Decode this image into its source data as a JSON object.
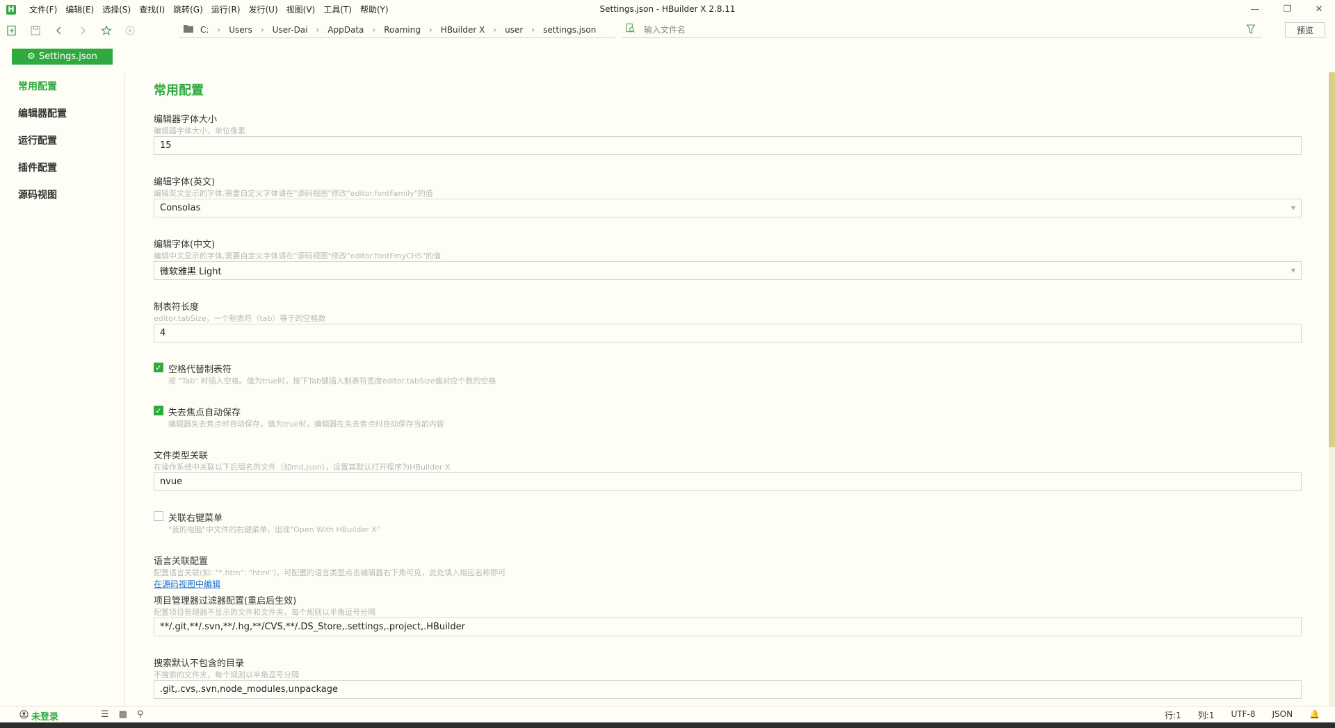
{
  "window": {
    "title": "Settings.json - HBuilder X 2.8.11",
    "logo": "H"
  },
  "menu": [
    "文件(F)",
    "编辑(E)",
    "选择(S)",
    "查找(I)",
    "跳转(G)",
    "运行(R)",
    "发行(U)",
    "视图(V)",
    "工具(T)",
    "帮助(Y)"
  ],
  "breadcrumb": [
    "C:",
    "Users",
    "User-Dai",
    "AppData",
    "Roaming",
    "HBuilder X",
    "user",
    "settings.json"
  ],
  "search": {
    "placeholder": "输入文件名"
  },
  "toolbar": {
    "preview_label": "预览"
  },
  "tab": {
    "label": "Settings.json"
  },
  "sidenav": {
    "items": [
      "常用配置",
      "编辑器配置",
      "运行配置",
      "插件配置",
      "源码视图"
    ]
  },
  "section": {
    "title": "常用配置"
  },
  "fields": {
    "font_size": {
      "label": "编辑器字体大小",
      "desc": "编辑器字体大小，单位像素",
      "value": "15"
    },
    "font_en": {
      "label": "编辑字体(英文)",
      "desc": "编辑英文显示的字体,需要自定义字体请在\"源码视图\"修改\"editor.fontFamily\"的值",
      "value": "Consolas"
    },
    "font_cn": {
      "label": "编辑字体(中文)",
      "desc": "编辑中文显示的字体,需要自定义字体请在\"源码视图\"修改\"editor.fontFmyCHS\"的值",
      "value": "微软雅黑 Light"
    },
    "tab_size": {
      "label": "制表符长度",
      "desc": "editor.tabSize，一个制表符（tab）等于的空格数",
      "value": "4"
    },
    "insert_spaces": {
      "label": "空格代替制表符",
      "desc": "按 \"Tab\" 时插入空格。值为true时，按下Tab键插入制表符宽度editor.tabSize值对应个数的空格",
      "checked": true
    },
    "auto_save": {
      "label": "失去焦点自动保存",
      "desc": "编辑器失去焦点时自动保存。值为true时，编辑器在失去焦点时自动保存当前内容",
      "checked": true
    },
    "file_assoc": {
      "label": "文件类型关联",
      "desc": "在操作系统中关联以下后缀名的文件（如md,json），设置其默认打开程序为HBuilder X",
      "value": "nvue"
    },
    "context_menu": {
      "label": "关联右键菜单",
      "desc": "\"我的电脑\"中文件的右键菜单，出现\"Open With HBuilder X\"",
      "checked": false
    },
    "lang_assoc": {
      "label": "语言关联配置",
      "desc": "配置语言关联(如: \"*.htm\": \"html\")，可配置的语言类型点击编辑器右下角可见，此处填入相应名称即可",
      "link": "在源码视图中编辑"
    },
    "project_filter": {
      "label": "项目管理器过滤器配置(重启后生效)",
      "desc": "配置项目管理器不显示的文件和文件夹，每个规则以半角逗号分隔",
      "value": "**/.git,**/.svn,**/.hg,**/CVS,**/.DS_Store,.settings,.project,.HBuilder"
    },
    "search_exclude": {
      "label": "搜索默认不包含的目录",
      "desc": "不搜索的文件夹，每个规则以半角逗号分隔",
      "value": ".git,.cvs,.svn,node_modules,unpackage"
    }
  },
  "status": {
    "login": "未登录",
    "line": "行:1",
    "col": "列:1",
    "encoding": "UTF-8",
    "language": "JSON"
  },
  "colors": {
    "accent": "#2eaa3f",
    "background": "#fffef6",
    "link": "#1a6fd0"
  }
}
